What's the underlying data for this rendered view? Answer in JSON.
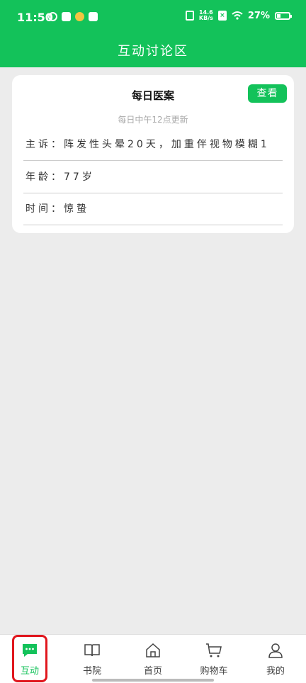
{
  "status_bar": {
    "time": "11:50",
    "net_speed_top": "14.6",
    "net_speed_bottom": "KB/s",
    "battery": "27%"
  },
  "header": {
    "title": "互动讨论区"
  },
  "card": {
    "title": "每日医案",
    "button_label": "查看",
    "subtitle": "每日中午12点更新",
    "rows": [
      {
        "label": "主诉：",
        "value": "阵发性头晕20天，加重伴视物模糊1"
      },
      {
        "label": "年龄：",
        "value": "77岁"
      },
      {
        "label": "时间：",
        "value": "惊蛰"
      }
    ]
  },
  "tabs": [
    {
      "label": "互动",
      "icon": "chat-bubble-icon"
    },
    {
      "label": "书院",
      "icon": "book-icon"
    },
    {
      "label": "首页",
      "icon": "home-icon"
    },
    {
      "label": "购物车",
      "icon": "cart-icon"
    },
    {
      "label": "我的",
      "icon": "user-icon"
    }
  ],
  "colors": {
    "accent": "#13c25a",
    "highlight": "#e0161d"
  }
}
